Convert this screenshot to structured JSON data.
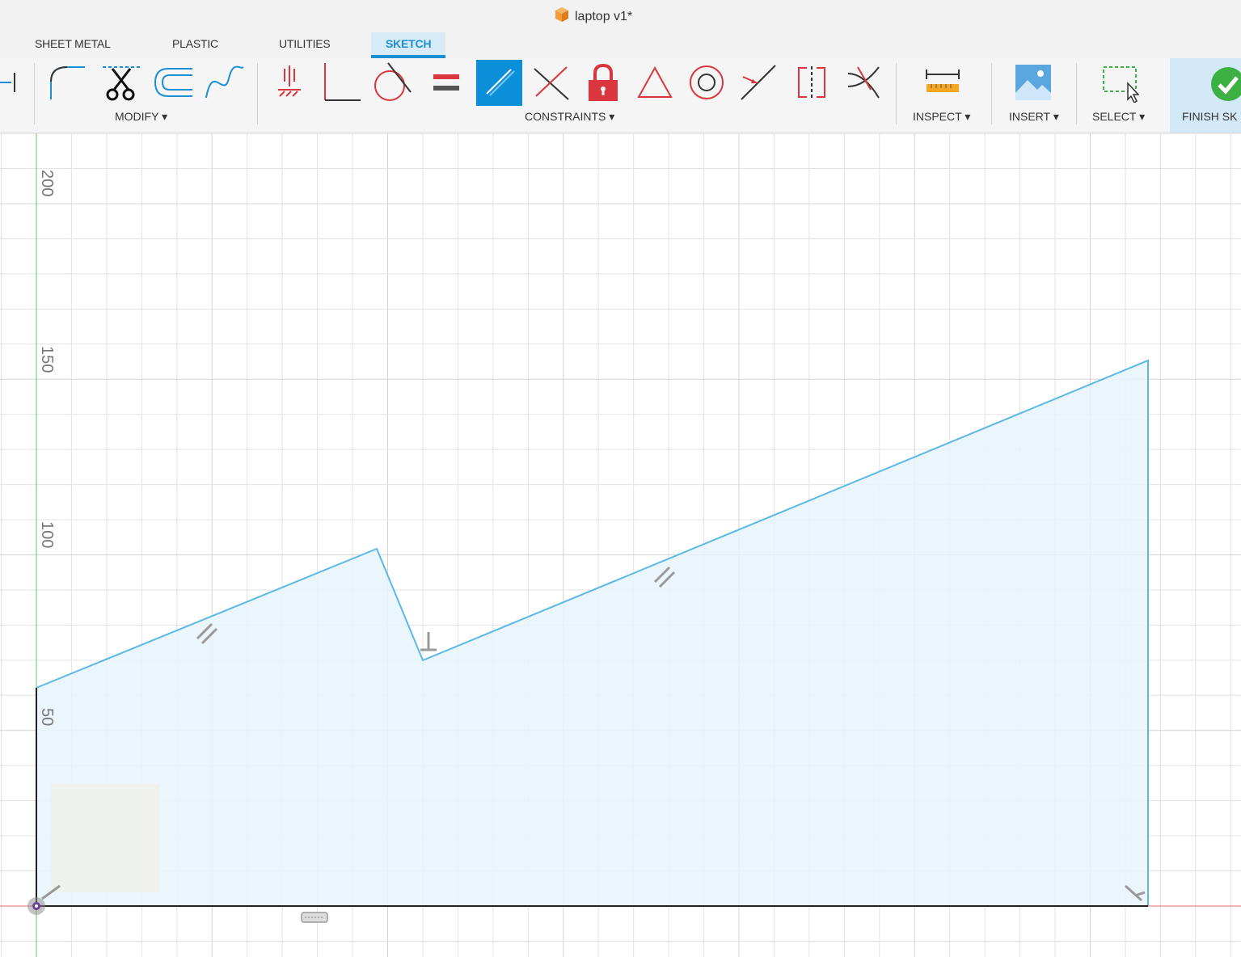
{
  "window": {
    "title": "laptop v1*",
    "title_icon": "box-icon"
  },
  "tabs": [
    {
      "label": "SHEET METAL",
      "active": false
    },
    {
      "label": "PLASTIC",
      "active": false
    },
    {
      "label": "UTILITIES",
      "active": false
    },
    {
      "label": "SKETCH",
      "active": true
    }
  ],
  "toolbar": {
    "groups": {
      "modify": "MODIFY ▾",
      "constraints": "CONSTRAINTS ▾",
      "inspect": "INSPECT ▾",
      "insert": "INSERT ▾",
      "select": "SELECT ▾",
      "finish": "FINISH SK"
    },
    "modify_tools": [
      "fillet-icon",
      "trim-icon",
      "offset-icon",
      "spline-icon"
    ],
    "constraint_tools": [
      "fix-icon",
      "perpendicular-icon",
      "tangent-icon",
      "equal-icon",
      "parallel-icon",
      "collinear-icon",
      "lock-icon",
      "triangle-icon",
      "concentric-icon",
      "midpoint-icon",
      "symmetry-icon",
      "curvature-icon"
    ],
    "active_constraint": "parallel-icon",
    "colors": {
      "accent": "#1a8fd6",
      "finish_green": "#3cb043",
      "constraint_red": "#d9363e"
    }
  },
  "sketch": {
    "ruler_labels": [
      "200",
      "150",
      "100",
      "50"
    ],
    "colors": {
      "profile_line": "#5ab8e6",
      "profile_fill": "#e8f4fc",
      "grid": "#e3e3e3",
      "axis_x": "#e36b6b",
      "axis_y": "#5ec95e"
    }
  }
}
